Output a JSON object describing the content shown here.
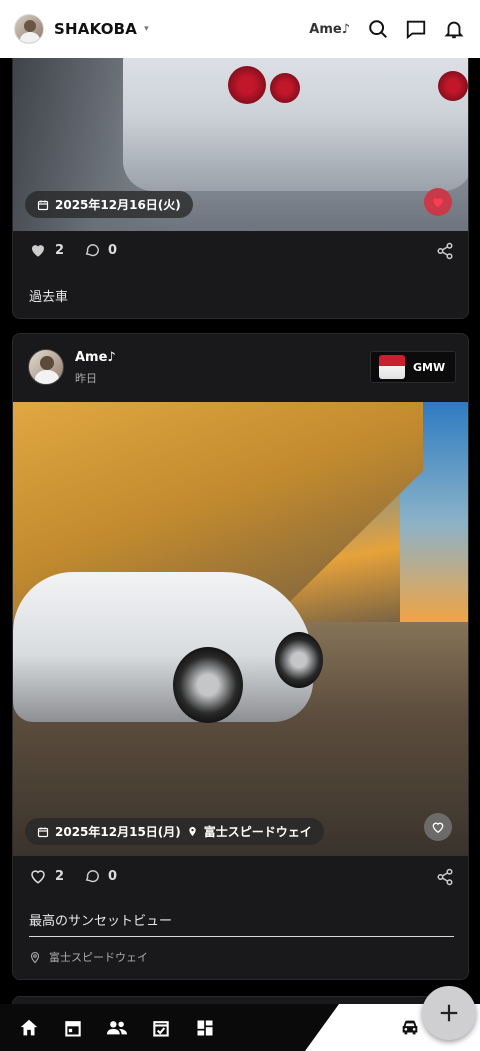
{
  "header": {
    "team_name": "SHAKOBA",
    "caret": "▾",
    "username": "Ame♪"
  },
  "post1": {
    "date": "2025年12月16日(火)",
    "likes": "2",
    "comments": "0",
    "caption": "過去車",
    "liked": true
  },
  "post2": {
    "author": "Ame♪",
    "time": "昨日",
    "team": "GMW",
    "date": "2025年12月15日(月)",
    "location": "富士スピードウェイ",
    "likes": "2",
    "comments": "0",
    "caption": "最高のサンセットビュー",
    "place": "富士スピードウェイ",
    "liked": false
  },
  "fab": {
    "label": "+"
  },
  "colors": {
    "like_active": "#e5344d",
    "accent": "#ffffff"
  }
}
